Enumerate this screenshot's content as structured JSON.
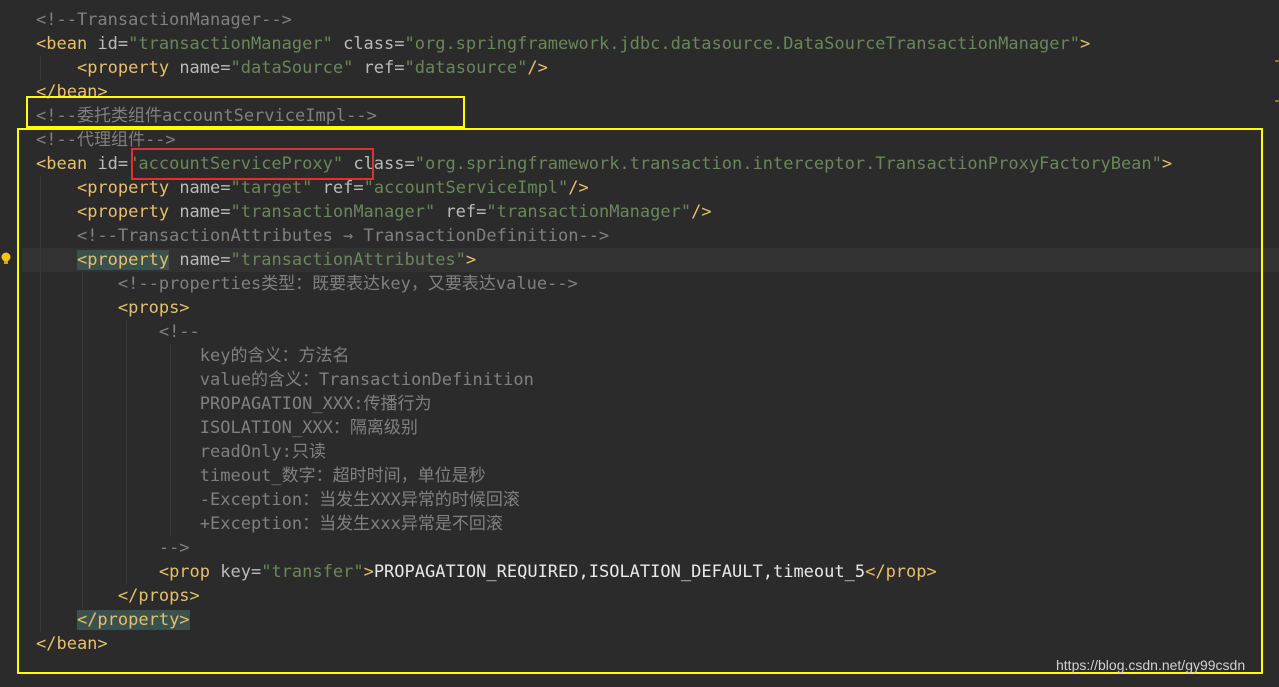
{
  "editor": {
    "lines": [
      {
        "comment": "<!--TransactionManager-->"
      },
      {
        "tag_open": "<bean",
        "attr1_name": " id=",
        "attr1_value": "\"transactionManager\"",
        "attr2_name": " class=",
        "attr2_value": "\"org.springframework.jdbc.datasource.DataSourceTransactionManager\"",
        "tag_close": ">"
      },
      {
        "indent": "    ",
        "tag_open": "<property",
        "attr1_name": " name=",
        "attr1_value": "\"dataSource\"",
        "attr2_name": " ref=",
        "attr2_value": "\"datasource\"",
        "tag_close": "/>"
      },
      {
        "tag_open": "</bean>"
      },
      {
        "comment": "<!--委托类组件accountServiceImpl-->"
      },
      {
        "comment": "<!--代理组件-->"
      },
      {
        "tag_open": "<bean",
        "attr1_name": " id=",
        "attr1_value": "\"accountServiceProxy\"",
        "attr2_name": " class=",
        "attr2_value": "\"org.springframework.transaction.interceptor.TransactionProxyFactoryBean\"",
        "tag_close": ">"
      },
      {
        "indent": "    ",
        "tag_open": "<property",
        "attr1_name": " name=",
        "attr1_value": "\"target\"",
        "attr2_name": " ref=",
        "attr2_value": "\"accountServiceImpl\"",
        "tag_close": "/>"
      },
      {
        "indent": "    ",
        "tag_open": "<property",
        "attr1_name": " name=",
        "attr1_value": "\"transactionManager\"",
        "attr2_name": " ref=",
        "attr2_value": "\"transactionManager\"",
        "tag_close": "/>"
      },
      {
        "indent": "    ",
        "comment": "<!--TransactionAttributes → TransactionDefinition-->"
      },
      {
        "indent": "    ",
        "tag_open": "<property",
        "attr1_name": " name=",
        "attr1_value": "\"transactionAttributes\"",
        "tag_close": ">"
      },
      {
        "indent": "        ",
        "comment": "<!--properties类型：既要表达key，又要表达value-->"
      },
      {
        "indent": "        ",
        "tag_open": "<props>"
      },
      {
        "indent": "            ",
        "comment": "<!--"
      },
      {
        "indent": "                ",
        "comment": "key的含义：方法名"
      },
      {
        "indent": "                ",
        "comment": "value的含义：TransactionDefinition"
      },
      {
        "indent": "                ",
        "comment": "PROPAGATION_XXX:传播行为"
      },
      {
        "indent": "                ",
        "comment": "ISOLATION_XXX：隔离级别"
      },
      {
        "indent": "                ",
        "comment": "readOnly:只读"
      },
      {
        "indent": "                ",
        "comment": "timeout_数字：超时时间，单位是秒"
      },
      {
        "indent": "                ",
        "comment": "-Exception：当发生XXX异常的时候回滚"
      },
      {
        "indent": "                ",
        "comment": "+Exception：当发生xxx异常是不回滚"
      },
      {
        "indent": "            ",
        "comment": "-->"
      },
      {
        "indent": "            ",
        "tag_open": "<prop",
        "attr1_name": " key=",
        "attr1_value": "\"transfer\"",
        "tag_close": ">",
        "text": "PROPAGATION_REQUIRED,ISOLATION_DEFAULT,timeout_5",
        "tag_end": "</prop>"
      },
      {
        "indent": "        ",
        "tag_open": "</props>"
      },
      {
        "indent": "    ",
        "tag_open": "</property>"
      },
      {
        "tag_open": "</bean>"
      }
    ]
  },
  "watermark": "https://blog.csdn.net/gy99csdn",
  "colors": {
    "background": "#2b2b2b",
    "tag": "#e8bf6a",
    "attribute": "#bababa",
    "string": "#6a8759",
    "comment": "#808080",
    "highlight_box": "#ffff00",
    "focus_box": "#e03131"
  }
}
